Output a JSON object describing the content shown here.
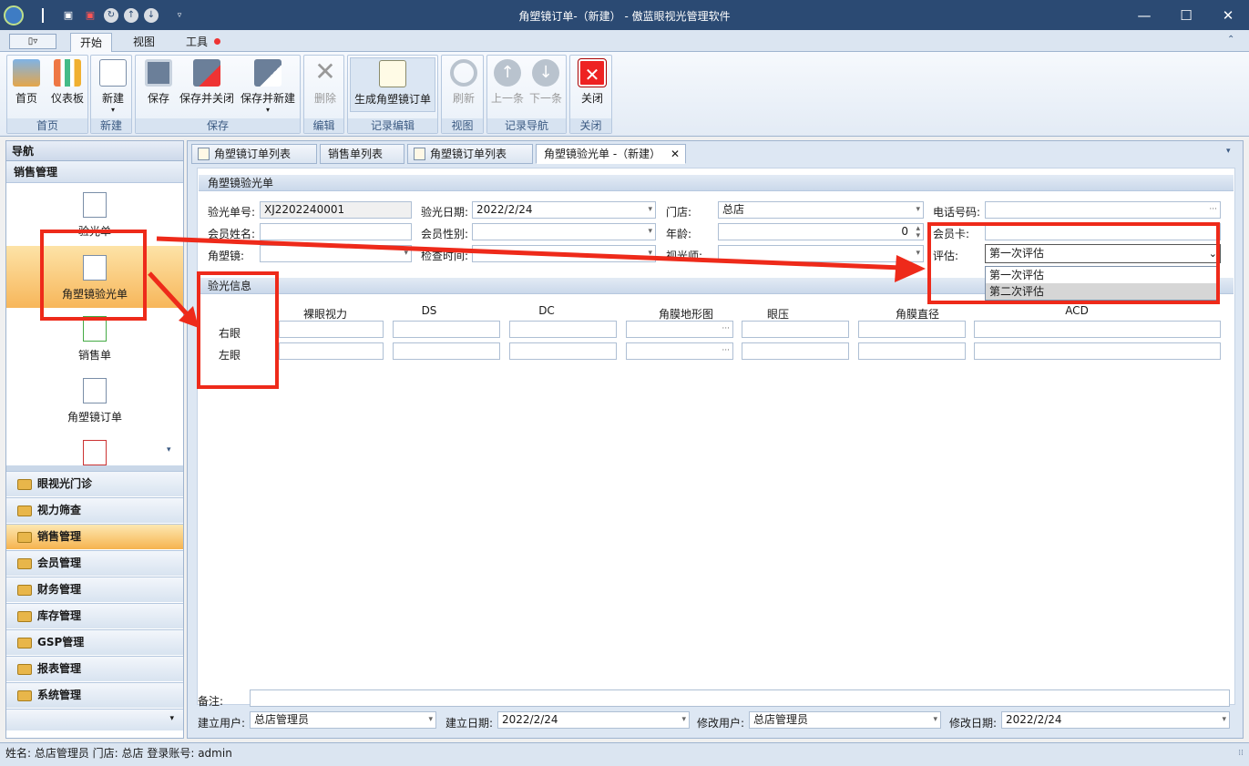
{
  "window": {
    "title": "角塑镜订单-（新建） - 傲蓝眼视光管理软件",
    "minimize_icon": "minimize-icon",
    "maximize_icon": "maximize-icon",
    "close_icon": "close-icon"
  },
  "ribbon": {
    "tabs": [
      "开始",
      "视图",
      "工具"
    ],
    "app_menu": "▯▿",
    "groups": [
      {
        "label": "首页",
        "buttons": [
          {
            "label": "首页",
            "icon": "home-icon"
          },
          {
            "label": "仪表板",
            "icon": "dashboard-icon"
          }
        ]
      },
      {
        "label": "新建",
        "buttons": [
          {
            "label": "新建",
            "icon": "new-document-icon"
          }
        ]
      },
      {
        "label": "保存",
        "buttons": [
          {
            "label": "保存",
            "icon": "save-icon"
          },
          {
            "label": "保存并关闭",
            "icon": "save-close-icon"
          },
          {
            "label": "保存并新建",
            "icon": "save-new-icon"
          }
        ]
      },
      {
        "label": "编辑",
        "buttons": [
          {
            "label": "删除",
            "icon": "delete-icon"
          }
        ]
      },
      {
        "label": "记录编辑",
        "buttons": [
          {
            "label": "生成角塑镜订单",
            "icon": "generate-order-icon"
          }
        ]
      },
      {
        "label": "视图",
        "buttons": [
          {
            "label": "刷新",
            "icon": "refresh-icon"
          }
        ]
      },
      {
        "label": "记录导航",
        "buttons": [
          {
            "label": "上一条",
            "icon": "prev-icon"
          },
          {
            "label": "下一条",
            "icon": "next-icon"
          }
        ]
      },
      {
        "label": "关闭",
        "buttons": [
          {
            "label": "关闭",
            "icon": "close-red-icon"
          }
        ]
      }
    ]
  },
  "sidebar": {
    "title": "导航",
    "section": "销售管理",
    "items": [
      {
        "label": "验光单"
      },
      {
        "label": "角塑镜验光单"
      },
      {
        "label": "销售单"
      },
      {
        "label": "角塑镜订单"
      }
    ],
    "categories": [
      "眼视光门诊",
      "视力筛查",
      "销售管理",
      "会员管理",
      "财务管理",
      "库存管理",
      "GSP管理",
      "报表管理",
      "系统管理"
    ]
  },
  "doc_tabs": [
    "角塑镜订单列表",
    "销售单列表",
    "角塑镜订单列表",
    "角塑镜验光单 -（新建）"
  ],
  "form": {
    "section1": "角塑镜验光单",
    "labels": {
      "order_no": "验光单号:",
      "date": "验光日期:",
      "store": "门店:",
      "phone": "电话号码:",
      "member_name": "会员姓名:",
      "gender": "会员性别:",
      "age": "年龄:",
      "member_card": "会员卡:",
      "lens": "角塑镜:",
      "check_time": "检查时间:",
      "optometrist": "视光师:",
      "eval": "评估:"
    },
    "values": {
      "order_no": "XJ2202240001",
      "date": "2022/2/24",
      "store": "总店",
      "phone": "",
      "member_name": "",
      "gender": "",
      "age": "0",
      "member_card": "",
      "lens": "",
      "check_time": "",
      "optometrist": "",
      "eval": "第一次评估"
    },
    "eval_options": [
      "第一次评估",
      "第二次评估"
    ],
    "section2": "验光信息",
    "columns": [
      "裸眼视力",
      "DS",
      "DC",
      "角膜地形图",
      "眼压",
      "角膜直径",
      "ACD"
    ],
    "rows": [
      "右眼",
      "左眼"
    ],
    "remark_label": "备注:",
    "footer": {
      "created_user_label": "建立用户:",
      "created_user": "总店管理员",
      "created_date_label": "建立日期:",
      "created_date": "2022/2/24",
      "modified_user_label": "修改用户:",
      "modified_user": "总店管理员",
      "modified_date_label": "修改日期:",
      "modified_date": "2022/2/24"
    }
  },
  "statusbar": "姓名: 总店管理员  门店: 总店  登录账号: admin"
}
